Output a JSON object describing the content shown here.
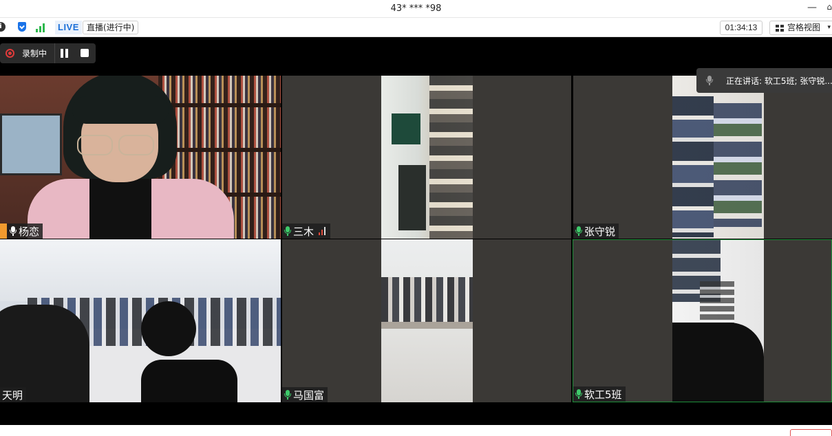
{
  "window": {
    "title": "43* *** *98",
    "minimize_icon": "minimize-icon",
    "pin_icon": "pin-icon"
  },
  "infobar": {
    "info_icon": "info-icon",
    "security_icon": "shield-icon",
    "signal_icon": "network-signal-icon",
    "live_badge": "LIVE",
    "live_status": "直播(进行中)",
    "timer": "01:34:13",
    "view_button": "宫格视图",
    "view_caret": "▾"
  },
  "recording": {
    "label": "录制中",
    "pause_icon": "pause-icon",
    "stop_icon": "stop-icon",
    "color": "#e03a3a"
  },
  "speaking": {
    "text": "正在讲话: 软工5班; 张守锐..."
  },
  "participants": [
    {
      "name": "杨恋",
      "host": true,
      "mic": "on"
    },
    {
      "name": "三木",
      "mic": "active",
      "signal": "weak"
    },
    {
      "name": "张守锐",
      "mic": "active"
    },
    {
      "name": "天明",
      "mic": "none"
    },
    {
      "name": "马国富",
      "mic": "active"
    },
    {
      "name": "软工5班",
      "mic": "active",
      "active_speaker": true
    }
  ],
  "colors": {
    "active_speaker_border": "#1f8f3a",
    "mic_active": "#3ec96a",
    "host_badge": "#f29a2e"
  }
}
